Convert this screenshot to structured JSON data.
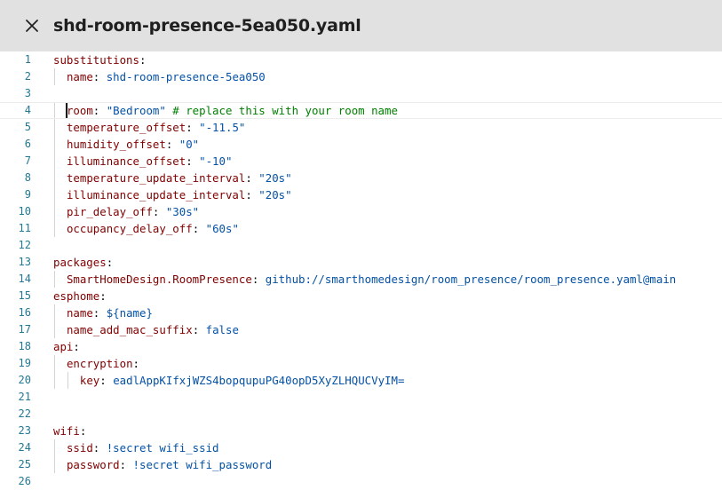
{
  "header": {
    "title": "shd-room-presence-5ea050.yaml",
    "close_icon": "close-icon"
  },
  "editor": {
    "lines": [
      {
        "n": "1",
        "indent": 0,
        "key": "substitutions",
        "sep": ":",
        "value": "",
        "comment": ""
      },
      {
        "n": "2",
        "indent": 1,
        "key": "name",
        "sep": ": ",
        "value": "shd-room-presence-5ea050",
        "comment": ""
      },
      {
        "n": "3",
        "indent": 0,
        "key": "",
        "sep": "",
        "value": "",
        "comment": ""
      },
      {
        "n": "4",
        "indent": 1,
        "key": "room",
        "sep": ": ",
        "value": "\"Bedroom\"",
        "comment": " # replace this with your room name"
      },
      {
        "n": "5",
        "indent": 1,
        "key": "temperature_offset",
        "sep": ": ",
        "value": "\"-11.5\"",
        "comment": ""
      },
      {
        "n": "6",
        "indent": 1,
        "key": "humidity_offset",
        "sep": ": ",
        "value": "\"0\"",
        "comment": ""
      },
      {
        "n": "7",
        "indent": 1,
        "key": "illuminance_offset",
        "sep": ": ",
        "value": "\"-10\"",
        "comment": ""
      },
      {
        "n": "8",
        "indent": 1,
        "key": "temperature_update_interval",
        "sep": ": ",
        "value": "\"20s\"",
        "comment": ""
      },
      {
        "n": "9",
        "indent": 1,
        "key": "illuminance_update_interval",
        "sep": ": ",
        "value": "\"20s\"",
        "comment": ""
      },
      {
        "n": "10",
        "indent": 1,
        "key": "pir_delay_off",
        "sep": ": ",
        "value": "\"30s\"",
        "comment": ""
      },
      {
        "n": "11",
        "indent": 1,
        "key": "occupancy_delay_off",
        "sep": ": ",
        "value": "\"60s\"",
        "comment": ""
      },
      {
        "n": "12",
        "indent": 0,
        "key": "",
        "sep": "",
        "value": "",
        "comment": ""
      },
      {
        "n": "13",
        "indent": 0,
        "key": "packages",
        "sep": ":",
        "value": "",
        "comment": ""
      },
      {
        "n": "14",
        "indent": 1,
        "key": "SmartHomeDesign.RoomPresence",
        "sep": ": ",
        "value": "github://smarthomedesign/room_presence/room_presence.yaml@main",
        "comment": ""
      },
      {
        "n": "15",
        "indent": 0,
        "key": "esphome",
        "sep": ":",
        "value": "",
        "comment": ""
      },
      {
        "n": "16",
        "indent": 1,
        "key": "name",
        "sep": ": ",
        "value": "${name}",
        "comment": ""
      },
      {
        "n": "17",
        "indent": 1,
        "key": "name_add_mac_suffix",
        "sep": ": ",
        "value": "false",
        "comment": ""
      },
      {
        "n": "18",
        "indent": 0,
        "key": "api",
        "sep": ":",
        "value": "",
        "comment": ""
      },
      {
        "n": "19",
        "indent": 1,
        "key": "encryption",
        "sep": ":",
        "value": "",
        "comment": ""
      },
      {
        "n": "20",
        "indent": 2,
        "key": "key",
        "sep": ": ",
        "value": "eadlAppKIfxjWZS4bopqupuPG40opD5XyZLHQUCVyIM=",
        "comment": ""
      },
      {
        "n": "21",
        "indent": 0,
        "key": "",
        "sep": "",
        "value": "",
        "comment": ""
      },
      {
        "n": "22",
        "indent": 0,
        "key": "",
        "sep": "",
        "value": "",
        "comment": ""
      },
      {
        "n": "23",
        "indent": 0,
        "key": "wifi",
        "sep": ":",
        "value": "",
        "comment": ""
      },
      {
        "n": "24",
        "indent": 1,
        "key": "ssid",
        "sep": ": ",
        "value": "!secret wifi_ssid",
        "comment": ""
      },
      {
        "n": "25",
        "indent": 1,
        "key": "password",
        "sep": ": ",
        "value": "!secret wifi_password",
        "comment": ""
      },
      {
        "n": "26",
        "indent": 0,
        "key": "",
        "sep": "",
        "value": "",
        "comment": ""
      }
    ],
    "active_line": "4"
  },
  "colors": {
    "header_bg": "#e1e1e1",
    "line_number": "#237893",
    "key": "#800000",
    "value": "#0451a5",
    "comment": "#008000"
  }
}
